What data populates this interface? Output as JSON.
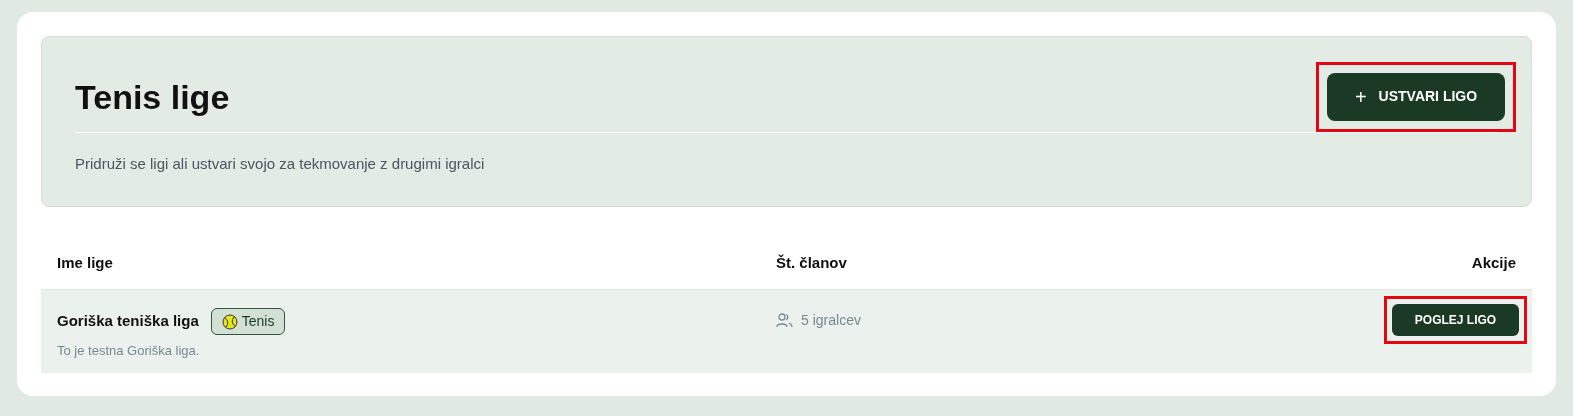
{
  "header": {
    "title": "Tenis lige",
    "subtitle": "Pridruži se ligi ali ustvari svojo za tekmovanje z drugimi igralci",
    "create_button": {
      "icon": "+",
      "label": "USTVARI LIGO",
      "highlighted": true
    }
  },
  "table": {
    "columns": [
      "Ime lige",
      "Št. članov",
      "Akcije"
    ],
    "rows": [
      {
        "name": "Goriška teniška liga",
        "tag": "Tenis",
        "description": "To je testna Goriška liga.",
        "members": "5 igralcev",
        "action": {
          "label": "POGLEJ LIGO",
          "highlighted": true
        }
      }
    ]
  }
}
